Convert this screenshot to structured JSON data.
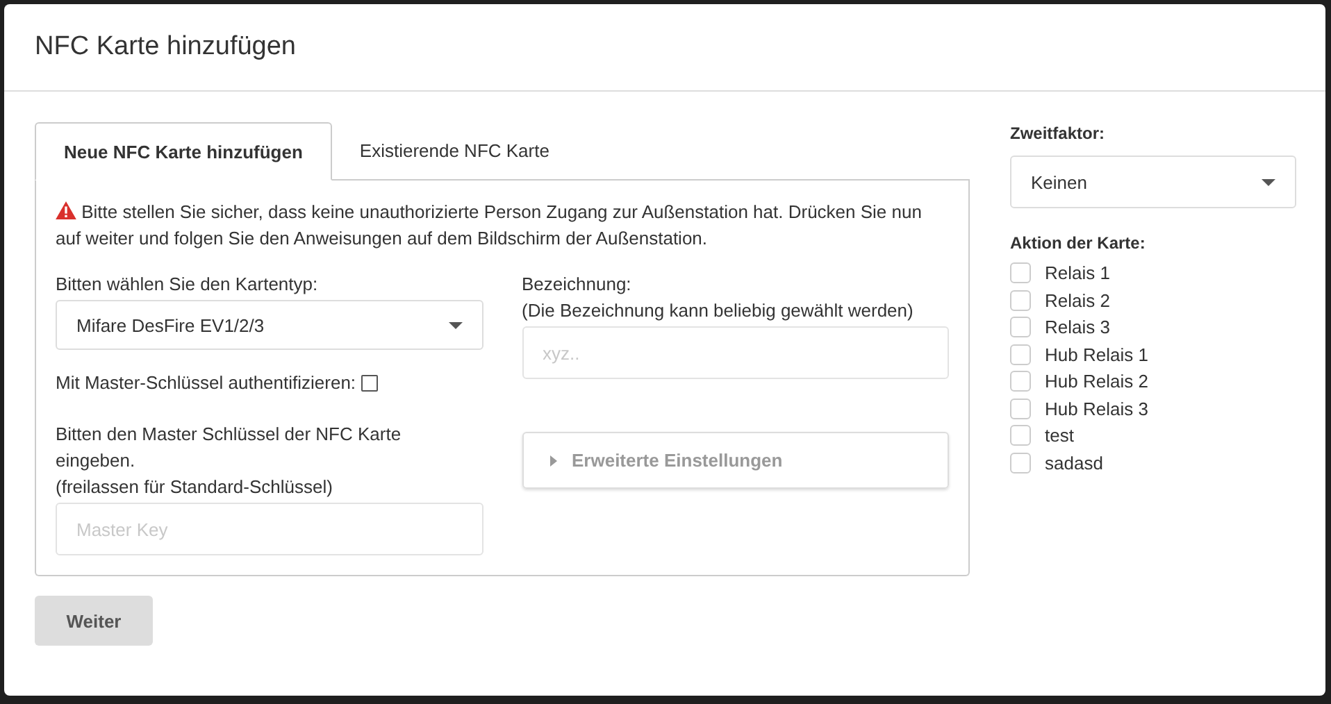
{
  "dialog": {
    "title": "NFC Karte hinzufügen"
  },
  "tabs": [
    {
      "label": "Neue NFC Karte hinzufügen",
      "selected": true
    },
    {
      "label": "Existierende NFC Karte",
      "selected": false
    }
  ],
  "warning": "Bitte stellen Sie sicher, dass keine unauthorizierte Person Zugang zur Außenstation hat. Drücken Sie nun auf weiter und folgen Sie den Anweisungen auf dem Bildschirm der Außenstation.",
  "card_type": {
    "label": "Bitten wählen Sie den Kartentyp:",
    "value": "Mifare DesFire EV1/2/3"
  },
  "name_field": {
    "label": "Bezeichnung:",
    "hint": "(Die Bezeichnung kann beliebig gewählt werden)",
    "placeholder": "xyz.."
  },
  "master_auth": {
    "label": "Mit Master-Schlüssel authentifizieren:",
    "checked": false
  },
  "master_key": {
    "label": "Bitten den Master Schlüssel der NFC Karte eingeben.",
    "hint": "(freilassen für Standard-Schlüssel)",
    "placeholder": "Master Key"
  },
  "advanced": {
    "label": "Erweiterte Einstellungen",
    "expanded": false
  },
  "next_button": {
    "label": "Weiter",
    "disabled": true
  },
  "second_factor": {
    "label": "Zweitfaktor:",
    "value": "Keinen"
  },
  "actions": {
    "label": "Aktion der Karte:",
    "items": [
      {
        "label": "Relais 1",
        "checked": false
      },
      {
        "label": "Relais 2",
        "checked": false
      },
      {
        "label": "Relais 3",
        "checked": false
      },
      {
        "label": "Hub Relais 1",
        "checked": false
      },
      {
        "label": "Hub Relais 2",
        "checked": false
      },
      {
        "label": "Hub Relais 3",
        "checked": false
      },
      {
        "label": "test",
        "checked": false
      },
      {
        "label": "sadasd",
        "checked": false
      }
    ]
  }
}
